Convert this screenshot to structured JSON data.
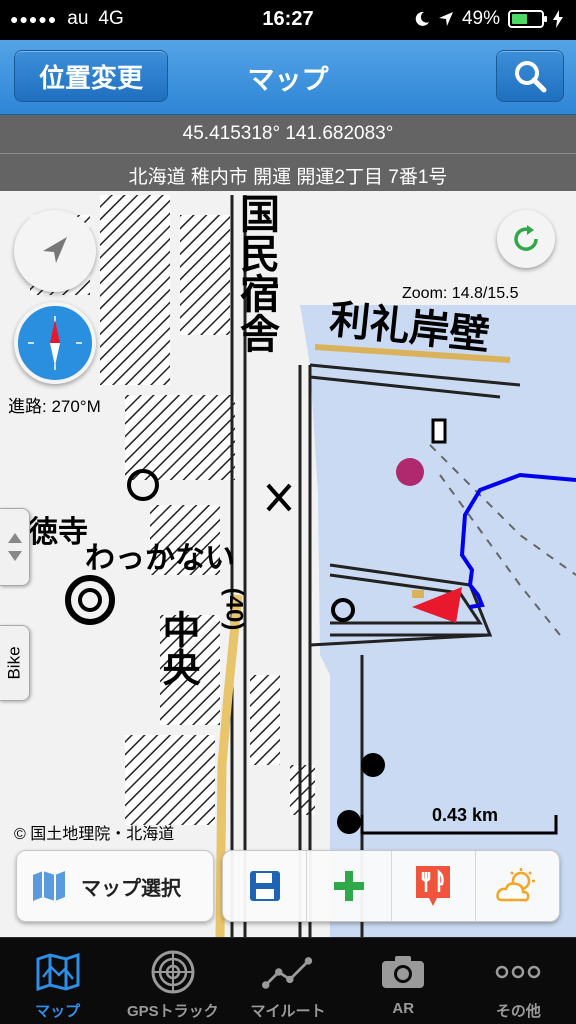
{
  "status_bar": {
    "carrier": "au",
    "network": "4G",
    "time": "16:27",
    "battery": "49%",
    "battery_level": 0.49,
    "icons": [
      "signal-dots-icon",
      "moon-icon",
      "location-arrow-icon",
      "battery-icon",
      "charging-bolt-icon"
    ]
  },
  "navbar": {
    "title": "マップ",
    "location_button": "位置変更",
    "search_icon": "search-icon"
  },
  "map": {
    "coordinates": "45.415318° 141.682083°",
    "address": "北海道 稚内市 開運 開運2丁目 7番1号",
    "zoom": "Zoom: 14.8/15.5",
    "heading": "進路: 270°M",
    "side_tab_label": "Bike",
    "scale": "0.43 km",
    "credit": "© 国土地理院・北海道",
    "place_labels": {
      "pier": "利礼岸壁",
      "inn": "国民宿舎",
      "district": "中央",
      "wakkanai": "わっかない",
      "route": "(40)",
      "temple": "徳寺"
    },
    "colors": {
      "sea": "#c9daf2",
      "track": "#0000ee",
      "marker": "#e8192c"
    }
  },
  "toolbar": {
    "map_select": "マップ選択",
    "actions": [
      "save-icon",
      "add-icon",
      "restaurant-icon",
      "weather-icon"
    ]
  },
  "tabbar": {
    "tabs": [
      {
        "label": "マップ",
        "icon": "map-icon",
        "active": true
      },
      {
        "label": "GPSトラック",
        "icon": "gps-track-icon",
        "active": false
      },
      {
        "label": "マイルート",
        "icon": "my-route-icon",
        "active": false
      },
      {
        "label": "AR",
        "icon": "camera-icon",
        "active": false
      },
      {
        "label": "その他",
        "icon": "more-icon",
        "active": false
      }
    ]
  }
}
